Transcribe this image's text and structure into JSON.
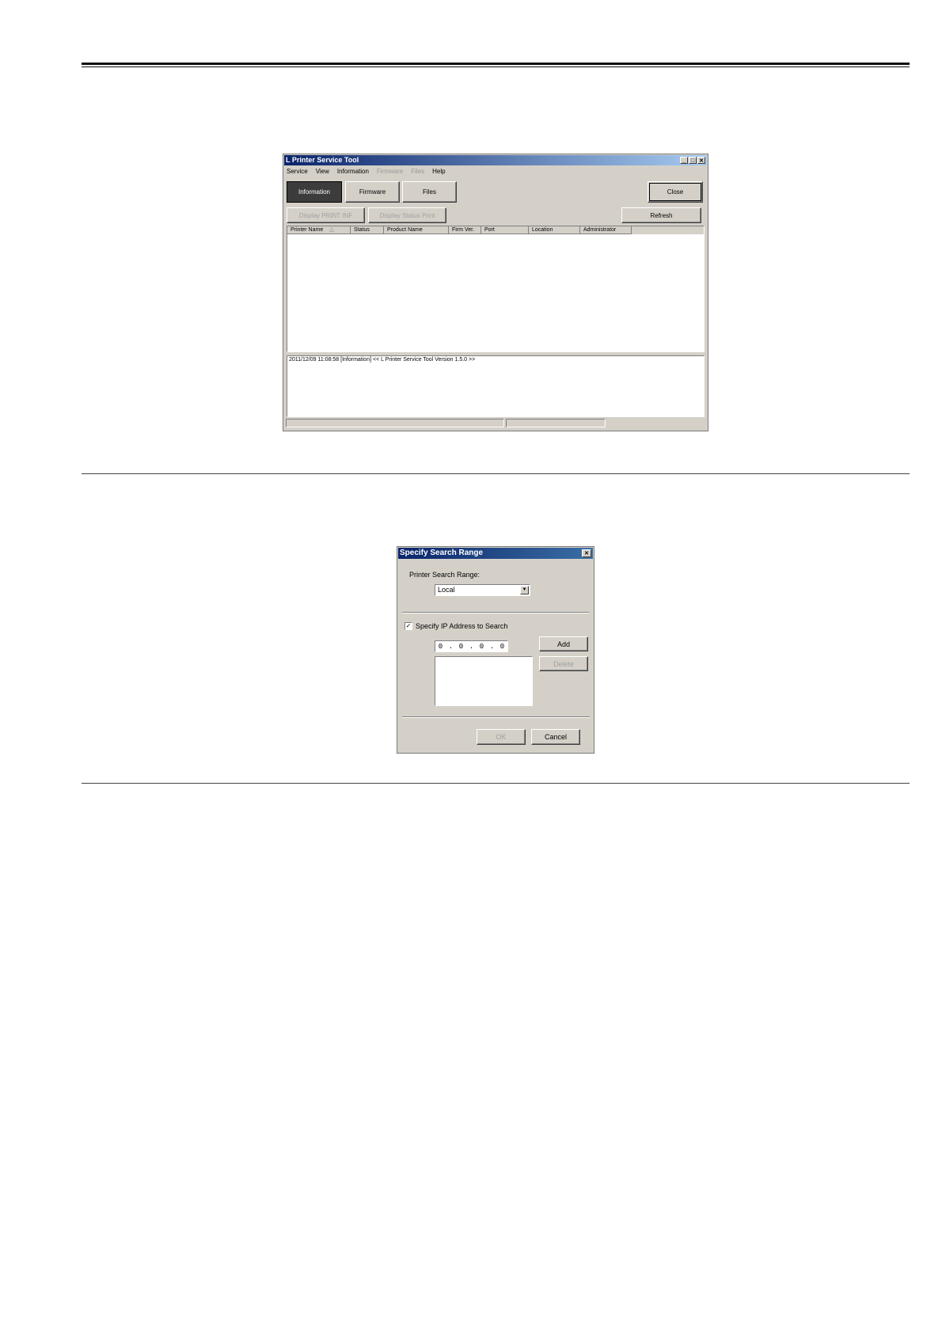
{
  "main_window": {
    "title": "L Printer Service Tool",
    "controls": {
      "minimize": "_",
      "maximize": "□",
      "close": "✕"
    },
    "menu": [
      {
        "label": "Service",
        "enabled": true
      },
      {
        "label": "View",
        "enabled": true
      },
      {
        "label": "Information",
        "enabled": true
      },
      {
        "label": "Firmware",
        "enabled": false
      },
      {
        "label": "Files",
        "enabled": false
      },
      {
        "label": "Help",
        "enabled": true
      }
    ],
    "tabs": {
      "information": "Information",
      "firmware": "Firmware",
      "files": "Files"
    },
    "close_button": "Close",
    "display_print_info": "Display PRINT INF",
    "display_status_print": "Display Status Print",
    "refresh_button": "Refresh",
    "columns": [
      "Printer Name",
      "Status",
      "Product Name",
      "Firm Ver.",
      "Port",
      "Location",
      "Administrator"
    ],
    "sort_indicator": "△",
    "log_line": "2011/12/09 11:08:58 [Information]   << L Printer Service Tool  Version 1.5.0 >>"
  },
  "search_dialog": {
    "title": "Specify Search Range",
    "close": "✕",
    "printer_search_range_label": "Printer Search Range:",
    "search_range_value": "Local",
    "combo_arrow": "▼",
    "specify_ip_label": "Specify IP Address to Search",
    "checkbox_mark": "✓",
    "ip_octets": [
      "0",
      "0",
      "0",
      "0"
    ],
    "ip_dot": ".",
    "add_button": "Add",
    "delete_button": "Delete",
    "ok_button": "OK",
    "cancel_button": "Cancel"
  }
}
